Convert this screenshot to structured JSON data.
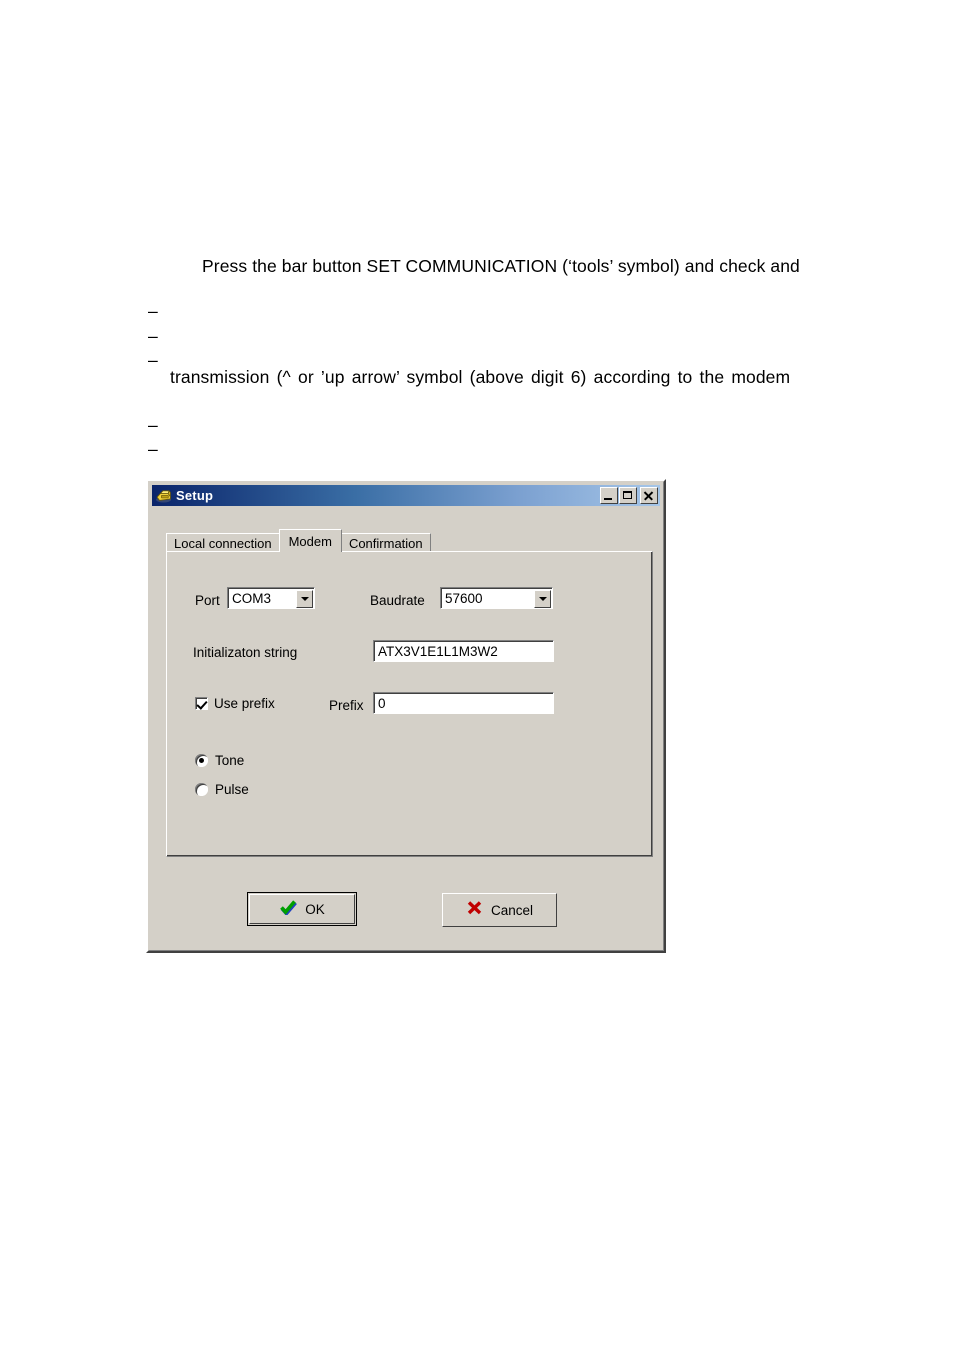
{
  "document": {
    "paragraph_1": "Press the bar button SET COMMUNICATION (‘tools’ symbol) and check and",
    "paragraph_2": "transmission (^ or ’up arrow’ symbol (above digit 6) according to the modem",
    "bullet_marks": [
      "–",
      "–",
      "–",
      "–",
      "–"
    ]
  },
  "dialog": {
    "title": "Setup",
    "title_icon": "telephone-modem-icon",
    "window_buttons": {
      "minimize": "minimize-icon",
      "maximize": "maximize-icon",
      "close": "close-icon"
    },
    "tabs": [
      {
        "label": "Local connection",
        "active": false
      },
      {
        "label": "Modem",
        "active": true
      },
      {
        "label": "Confirmation",
        "active": false
      }
    ],
    "fields": {
      "port": {
        "label": "Port",
        "value": "COM3",
        "control": "combobox",
        "arrow_icon": "chevron-down-icon"
      },
      "baudrate": {
        "label": "Baudrate",
        "value": "57600",
        "control": "combobox",
        "arrow_icon": "chevron-down-icon"
      },
      "init_string": {
        "label": "Initializaton string",
        "value": "ATX3V1E1L1M3W2",
        "control": "textbox"
      },
      "use_prefix": {
        "label": "Use prefix",
        "checked": true,
        "control": "checkbox"
      },
      "prefix": {
        "label": "Prefix",
        "value": "0",
        "control": "textbox"
      },
      "dial_mode": {
        "options": [
          {
            "label": "Tone",
            "selected": true
          },
          {
            "label": "Pulse",
            "selected": false
          }
        ]
      }
    },
    "buttons": {
      "ok": {
        "label": "OK",
        "icon": "green-check-icon",
        "default": true
      },
      "cancel": {
        "label": "Cancel",
        "icon": "red-x-icon",
        "default": false
      }
    }
  },
  "colors": {
    "face": "#d4d0c8",
    "title_start": "#0a246a",
    "title_end": "#a6c6e8",
    "ok_icon": "#00a000",
    "cancel_icon": "#c00000"
  }
}
